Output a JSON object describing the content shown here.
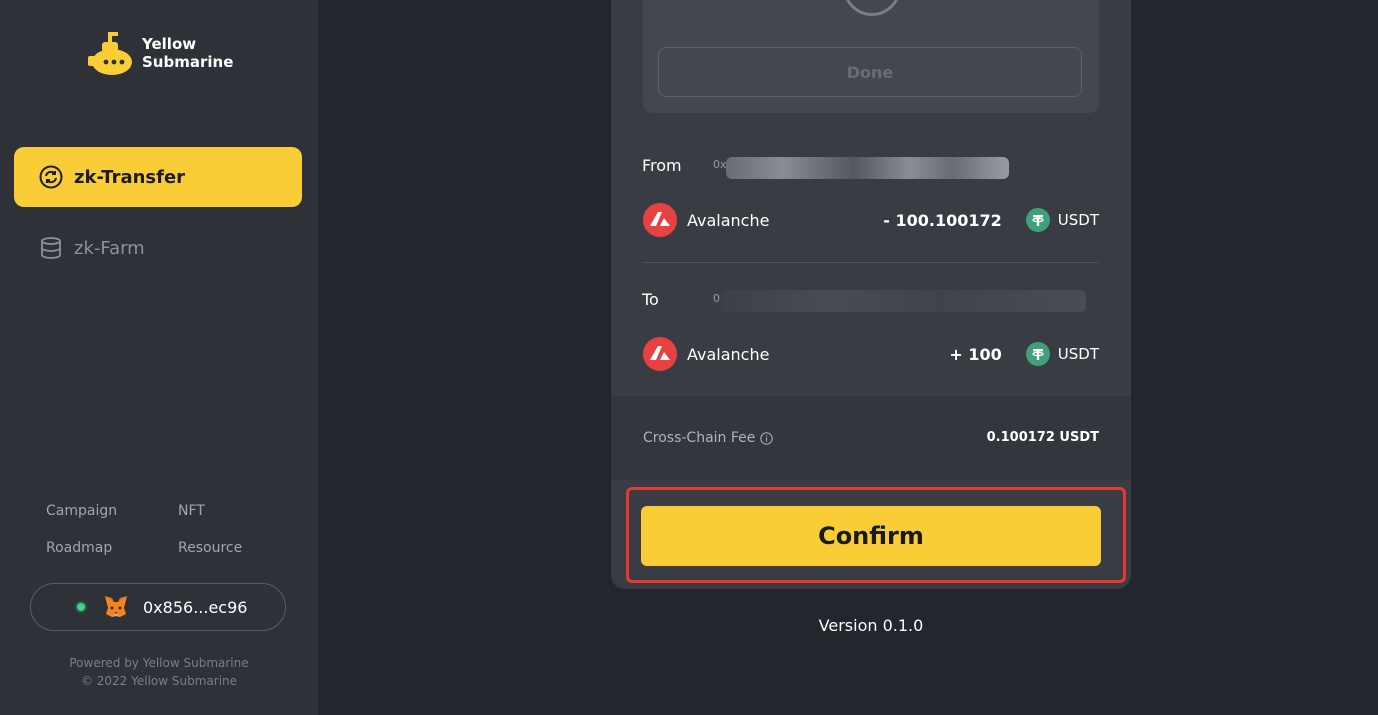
{
  "brand": {
    "line1": "Yellow",
    "line2": "Submarine"
  },
  "nav": [
    {
      "label": "zk-Transfer",
      "icon": "refresh-circle-icon",
      "active": true
    },
    {
      "label": "zk-Farm",
      "icon": "database-icon",
      "active": false
    }
  ],
  "footer_links": [
    "Campaign",
    "NFT",
    "Roadmap",
    "Resource"
  ],
  "wallet": {
    "address": "0x856...ec96",
    "icon": "metamask-fox-icon",
    "status": "connected"
  },
  "powered": {
    "line1": "Powered by Yellow Submarine",
    "line2": "© 2022 Yellow Submarine"
  },
  "modal": {
    "done_label": "Done",
    "from": {
      "label": "From",
      "address_prefix": "0x",
      "chain": "Avalanche",
      "amount": "- 100.100172",
      "token": "USDT"
    },
    "to": {
      "label": "To",
      "address_prefix": "0",
      "chain": "Avalanche",
      "amount": "+ 100",
      "token": "USDT"
    },
    "fee": {
      "label": "Cross-Chain Fee",
      "value": "0.100172 USDT"
    },
    "confirm_label": "Confirm"
  },
  "version": "Version 0.1.0",
  "colors": {
    "accent": "#f8cd35",
    "avalanche": "#e84142",
    "usdt": "#3fa07a",
    "highlight": "#e63a30"
  }
}
